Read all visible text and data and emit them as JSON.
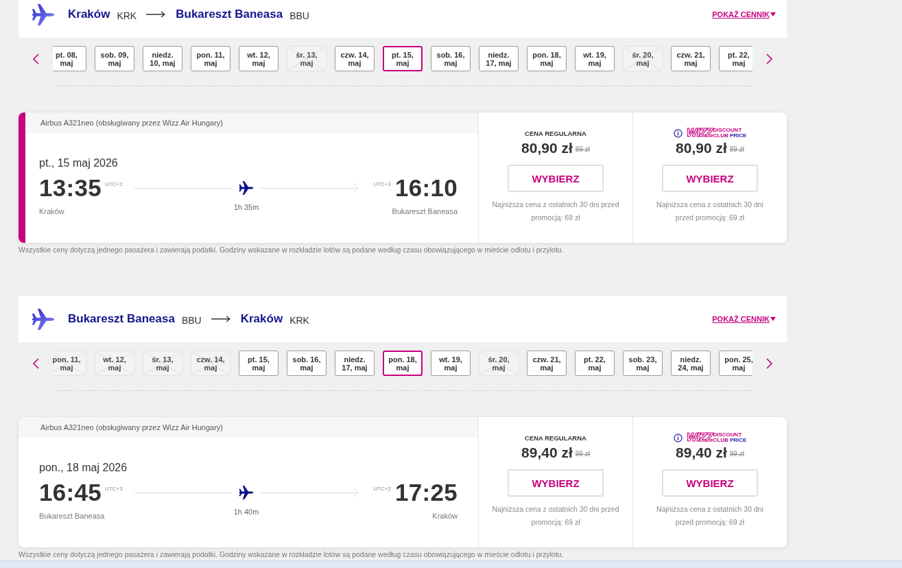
{
  "sections": [
    {
      "route": {
        "origin": "Kraków",
        "origin_code": "KRK",
        "destination": "Bukareszt Baneasa",
        "destination_code": "BBU"
      },
      "price_list_link": "POKAŻ CENNIK",
      "dates": [
        {
          "lines": [
            "pt. 08,",
            "maj"
          ],
          "selected": false,
          "disabled": false
        },
        {
          "lines": [
            "sob. 09,",
            "maj"
          ],
          "selected": false,
          "disabled": false
        },
        {
          "lines": [
            "niedz.",
            "10, maj"
          ],
          "selected": false,
          "disabled": false
        },
        {
          "lines": [
            "pon. 11,",
            "maj"
          ],
          "selected": false,
          "disabled": false
        },
        {
          "lines": [
            "wt. 12,",
            "maj"
          ],
          "selected": false,
          "disabled": false
        },
        {
          "lines": [
            "śr. 13,",
            "maj"
          ],
          "selected": false,
          "disabled": true
        },
        {
          "lines": [
            "czw. 14,",
            "maj"
          ],
          "selected": false,
          "disabled": false
        },
        {
          "lines": [
            "pt. 15,",
            "maj"
          ],
          "selected": true,
          "disabled": false
        },
        {
          "lines": [
            "sob. 16,",
            "maj"
          ],
          "selected": false,
          "disabled": false
        },
        {
          "lines": [
            "niedz.",
            "17, maj"
          ],
          "selected": false,
          "disabled": false
        },
        {
          "lines": [
            "pon. 18,",
            "maj"
          ],
          "selected": false,
          "disabled": false
        },
        {
          "lines": [
            "wt. 19,",
            "maj"
          ],
          "selected": false,
          "disabled": false
        },
        {
          "lines": [
            "śr. 20,",
            "maj"
          ],
          "selected": false,
          "disabled": true
        },
        {
          "lines": [
            "czw. 21,",
            "maj"
          ],
          "selected": false,
          "disabled": false
        },
        {
          "lines": [
            "pt. 22,",
            "maj"
          ],
          "selected": false,
          "disabled": false
        }
      ],
      "flight": {
        "selected": true,
        "aircraft": "Airbus A321neo (obsługiwany przez Wizz Air Hungary)",
        "date": "pt., 15 maj 2026",
        "departure": {
          "time": "13:35",
          "utc": "UTC+2",
          "city": "Kraków"
        },
        "duration": "1h 35m",
        "arrival": {
          "time": "16:10",
          "utc": "UTC+3",
          "city": "Bukareszt Baneasa"
        },
        "fares": [
          {
            "kind": "regular",
            "title": "CENA REGULARNA",
            "price": "80,90 zł",
            "old_price": "89 zł",
            "button": "WYBIERZ",
            "note": "Najniższa cena z ostatnich 30 dni przed promocją: 69 zł"
          },
          {
            "kind": "club",
            "logo": {
              "brand": "WIZZ",
              "top": "DISCOUNT",
              "bottom": [
                "CLUB",
                "PRICE"
              ]
            },
            "price": "80,90 zł",
            "old_price": "89 zł",
            "button": "WYBIERZ",
            "note": "Najniższa cena z ostatnich 30 dni przed promocją: 69 zł"
          }
        ]
      },
      "footnote": "Wszystkie ceny dotyczą jednego pasażera i zawierają podatki. Godziny wskazane w rozkładzie lotów są podane według czasu obowiązującego w mieście odlotu i przylotu."
    },
    {
      "route": {
        "origin": "Bukareszt Baneasa",
        "origin_code": "BBU",
        "destination": "Kraków",
        "destination_code": "KRK"
      },
      "price_list_link": "POKAŻ CENNIK",
      "dates": [
        {
          "lines": [
            "pon. 11,",
            "maj"
          ],
          "selected": false,
          "disabled": true
        },
        {
          "lines": [
            "wt. 12,",
            "maj"
          ],
          "selected": false,
          "disabled": true
        },
        {
          "lines": [
            "śr. 13,",
            "maj"
          ],
          "selected": false,
          "disabled": true
        },
        {
          "lines": [
            "czw. 14,",
            "maj"
          ],
          "selected": false,
          "disabled": true
        },
        {
          "lines": [
            "pt. 15,",
            "maj"
          ],
          "selected": false,
          "disabled": false
        },
        {
          "lines": [
            "sob. 16,",
            "maj"
          ],
          "selected": false,
          "disabled": false
        },
        {
          "lines": [
            "niedz.",
            "17, maj"
          ],
          "selected": false,
          "disabled": false
        },
        {
          "lines": [
            "pon. 18,",
            "maj"
          ],
          "selected": true,
          "disabled": false
        },
        {
          "lines": [
            "wt. 19,",
            "maj"
          ],
          "selected": false,
          "disabled": false
        },
        {
          "lines": [
            "śr. 20,",
            "maj"
          ],
          "selected": false,
          "disabled": true
        },
        {
          "lines": [
            "czw. 21,",
            "maj"
          ],
          "selected": false,
          "disabled": false
        },
        {
          "lines": [
            "pt. 22,",
            "maj"
          ],
          "selected": false,
          "disabled": false
        },
        {
          "lines": [
            "sob. 23,",
            "maj"
          ],
          "selected": false,
          "disabled": false
        },
        {
          "lines": [
            "niedz.",
            "24, maj"
          ],
          "selected": false,
          "disabled": false
        },
        {
          "lines": [
            "pon. 25,",
            "maj"
          ],
          "selected": false,
          "disabled": false
        }
      ],
      "flight": {
        "selected": false,
        "aircraft": "Airbus A321neo (obsługiwany przez Wizz Air Hungary)",
        "date": "pon., 18 maj 2026",
        "departure": {
          "time": "16:45",
          "utc": "UTC+3",
          "city": "Bukareszt Baneasa"
        },
        "duration": "1h 40m",
        "arrival": {
          "time": "17:25",
          "utc": "UTC+2",
          "city": "Kraków"
        },
        "fares": [
          {
            "kind": "regular",
            "title": "CENA REGULARNA",
            "price": "89,40 zł",
            "old_price": "99 zł",
            "button": "WYBIERZ",
            "note": "Najniższa cena z ostatnich 30 dni przed promocją: 69 zł"
          },
          {
            "kind": "club",
            "logo": {
              "brand": "WIZZ",
              "top": "DISCOUNT",
              "bottom": [
                "CLUB",
                "PRICE"
              ]
            },
            "price": "89,40 zł",
            "old_price": "99 zł",
            "button": "WYBIERZ",
            "note": "Najniższa cena z ostatnich 30 dni przed promocją: 69 zł"
          }
        ]
      },
      "footnote": "Wszystkie ceny dotyczą jednego pasażera i zawierają podatki. Godziny wskazane w rozkładzie lotów są podane według czasu obowiązującego w mieście odlotu i przylotu."
    }
  ]
}
